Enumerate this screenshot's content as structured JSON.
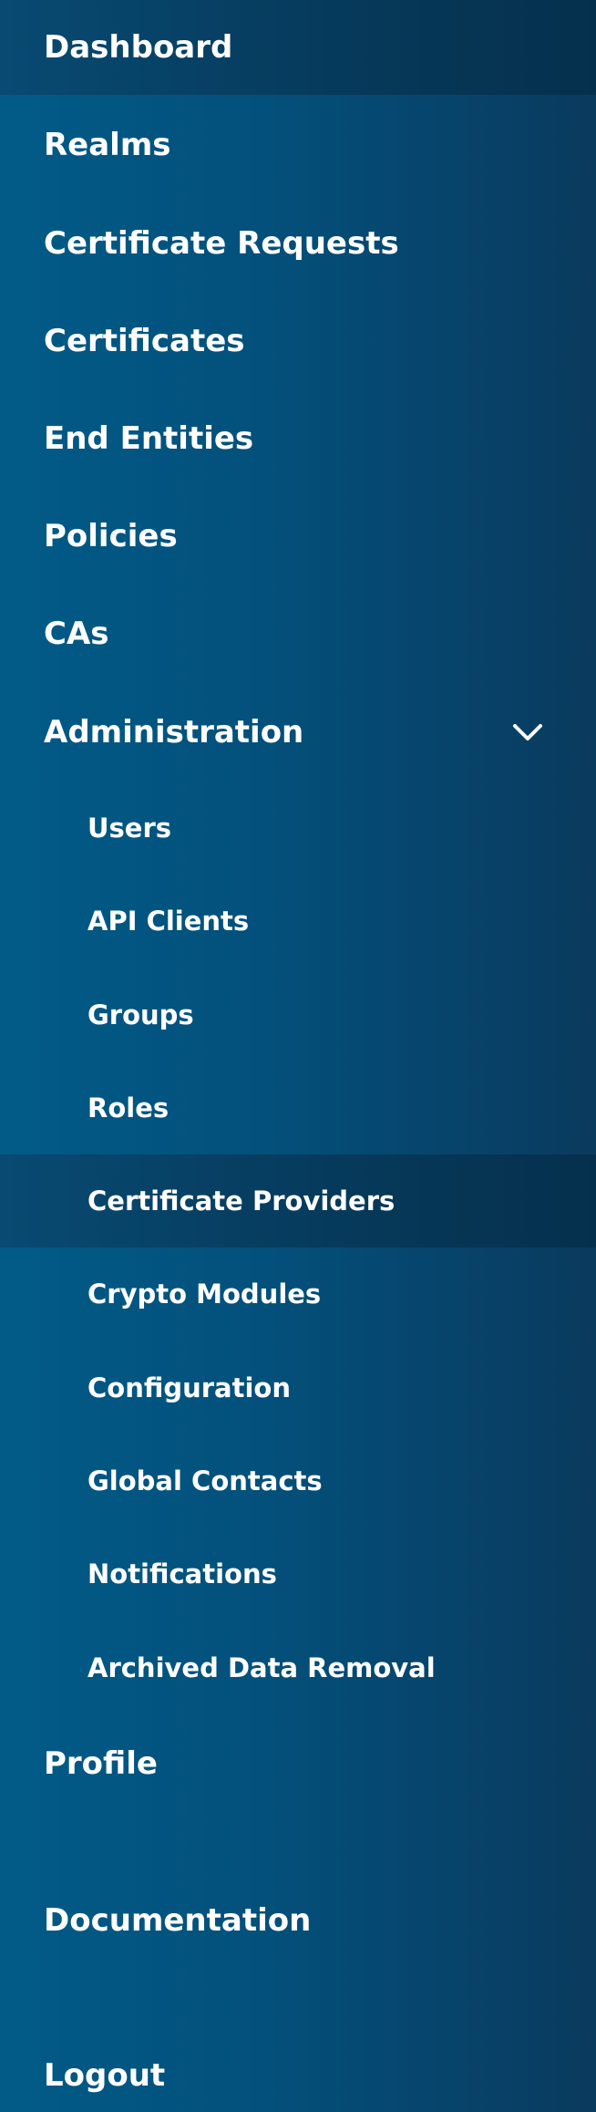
{
  "sidebar": {
    "dashboard": "Dashboard",
    "realms": "Realms",
    "certificate_requests": "Certificate Requests",
    "certificates": "Certificates",
    "end_entities": "End Entities",
    "policies": "Policies",
    "cas": "CAs",
    "administration": {
      "label": "Administration",
      "icon": "chevron-down-icon",
      "expanded": true,
      "items": [
        "Users",
        "API Clients",
        "Groups",
        "Roles",
        "Certificate Providers",
        "Crypto Modules",
        "Configuration",
        "Global Contacts",
        "Notifications",
        "Archived Data Removal"
      ],
      "active_item": "Certificate Providers"
    },
    "profile": "Profile",
    "documentation": "Documentation",
    "logout": "Logout"
  },
  "colors": {
    "background_start": "#025b87",
    "background_end": "#0a3a5e",
    "active_background": "#06395a",
    "text": "#ffffff"
  }
}
